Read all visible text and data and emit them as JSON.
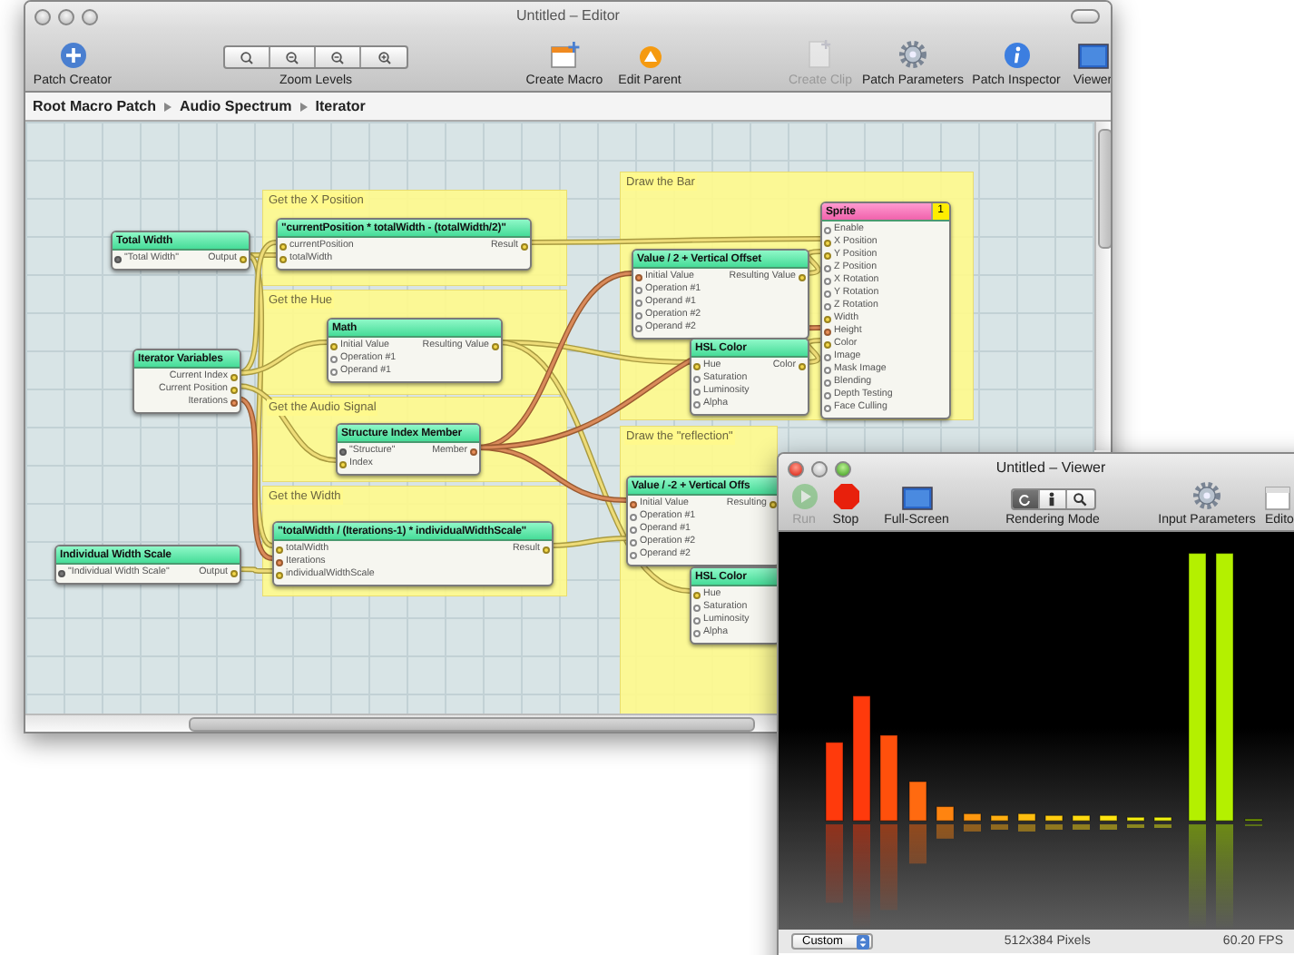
{
  "editor": {
    "title": "Untitled – Editor",
    "toolbar": [
      {
        "label": "Patch Creator",
        "kind": "patch-creator",
        "disabled": false
      },
      {
        "label": "Zoom Levels",
        "kind": "zoom",
        "disabled": false
      },
      {
        "label": "Create Macro",
        "kind": "macro",
        "disabled": false
      },
      {
        "label": "Edit Parent",
        "kind": "parent",
        "disabled": false
      },
      {
        "label": "Create Clip",
        "kind": "clip",
        "disabled": true
      },
      {
        "label": "Patch Parameters",
        "kind": "gear",
        "disabled": false
      },
      {
        "label": "Patch Inspector",
        "kind": "info",
        "disabled": false
      },
      {
        "label": "Viewer",
        "kind": "screen",
        "disabled": false
      }
    ],
    "breadcrumb": [
      "Root Macro Patch",
      "Audio Spectrum",
      "Iterator"
    ],
    "groups": [
      {
        "title": "Get the X Position"
      },
      {
        "title": "Get the Hue"
      },
      {
        "title": "Get the Audio Signal"
      },
      {
        "title": "Get the Width"
      },
      {
        "title": "Draw the Bar"
      },
      {
        "title": "Draw the \"reflection\""
      }
    ],
    "patches": [
      {
        "title": "Total Width",
        "kind": "processor",
        "inputs": [
          {
            "label": "\"Total Width\"",
            "kind": "fixed"
          }
        ],
        "outputs": [
          {
            "label": "Output",
            "kind": "linked"
          }
        ]
      },
      {
        "title": "\"currentPosition * totalWidth - (totalWidth/2)\"",
        "kind": "processor",
        "inputs": [
          {
            "label": "currentPosition",
            "kind": "linked"
          },
          {
            "label": "totalWidth",
            "kind": "linked"
          }
        ],
        "outputs": [
          {
            "label": "Result",
            "kind": "linked"
          }
        ]
      },
      {
        "title": "Iterator Variables",
        "kind": "processor",
        "outputs": [
          {
            "label": "Current Index",
            "kind": "linked"
          },
          {
            "label": "Current Position",
            "kind": "linked"
          },
          {
            "label": "Iterations",
            "kind": "index"
          }
        ]
      },
      {
        "title": "Math",
        "kind": "processor",
        "inputs": [
          {
            "label": "Initial Value",
            "kind": "linked"
          },
          {
            "label": "Operation #1",
            "kind": "open"
          },
          {
            "label": "Operand #1",
            "kind": "open"
          }
        ],
        "outputs": [
          {
            "label": "Resulting Value",
            "kind": "linked"
          }
        ]
      },
      {
        "title": "Structure Index Member",
        "kind": "processor",
        "inputs": [
          {
            "label": "\"Structure\"",
            "kind": "fixed"
          },
          {
            "label": "Index",
            "kind": "linked"
          }
        ],
        "outputs": [
          {
            "label": "Member",
            "kind": "index"
          }
        ]
      },
      {
        "title": "Individual Width Scale",
        "kind": "processor",
        "inputs": [
          {
            "label": "\"Individual Width Scale\"",
            "kind": "fixed"
          }
        ],
        "outputs": [
          {
            "label": "Output",
            "kind": "linked"
          }
        ]
      },
      {
        "title": "\"totalWidth / (Iterations-1) * individualWidthScale\"",
        "kind": "processor",
        "inputs": [
          {
            "label": "totalWidth",
            "kind": "linked"
          },
          {
            "label": "Iterations",
            "kind": "index"
          },
          {
            "label": "individualWidthScale",
            "kind": "linked"
          }
        ],
        "outputs": [
          {
            "label": "Result",
            "kind": "linked"
          }
        ]
      },
      {
        "title": "Value / 2 + Vertical Offset",
        "kind": "processor",
        "inputs": [
          {
            "label": "Initial Value",
            "kind": "index"
          },
          {
            "label": "Operation #1",
            "kind": "open"
          },
          {
            "label": "Operand #1",
            "kind": "open"
          },
          {
            "label": "Operation #2",
            "kind": "open"
          },
          {
            "label": "Operand #2",
            "kind": "open"
          }
        ],
        "outputs": [
          {
            "label": "Resulting Value",
            "kind": "linked"
          }
        ]
      },
      {
        "title": "HSL Color",
        "kind": "processor",
        "inputs": [
          {
            "label": "Hue",
            "kind": "linked"
          },
          {
            "label": "Saturation",
            "kind": "open"
          },
          {
            "label": "Luminosity",
            "kind": "open"
          },
          {
            "label": "Alpha",
            "kind": "open"
          }
        ],
        "outputs": [
          {
            "label": "Color",
            "kind": "linked"
          }
        ]
      },
      {
        "title": "Sprite",
        "kind": "consumer",
        "badge": "1",
        "inputs": [
          {
            "label": "Enable",
            "kind": "open"
          },
          {
            "label": "X Position",
            "kind": "linked"
          },
          {
            "label": "Y Position",
            "kind": "linked"
          },
          {
            "label": "Z Position",
            "kind": "open"
          },
          {
            "label": "X Rotation",
            "kind": "open"
          },
          {
            "label": "Y Rotation",
            "kind": "open"
          },
          {
            "label": "Z Rotation",
            "kind": "open"
          },
          {
            "label": "Width",
            "kind": "linked"
          },
          {
            "label": "Height",
            "kind": "index"
          },
          {
            "label": "Color",
            "kind": "linked"
          },
          {
            "label": "Image",
            "kind": "open"
          },
          {
            "label": "Mask Image",
            "kind": "open"
          },
          {
            "label": "Blending",
            "kind": "open"
          },
          {
            "label": "Depth Testing",
            "kind": "open"
          },
          {
            "label": "Face Culling",
            "kind": "open"
          }
        ]
      },
      {
        "title": "Value / -2 + Vertical Offs",
        "kind": "processor",
        "inputs": [
          {
            "label": "Initial Value",
            "kind": "index"
          },
          {
            "label": "Operation #1",
            "kind": "open"
          },
          {
            "label": "Operand #1",
            "kind": "open"
          },
          {
            "label": "Operation #2",
            "kind": "open"
          },
          {
            "label": "Operand #2",
            "kind": "open"
          }
        ],
        "outputs": [
          {
            "label": "Resulting",
            "kind": "linked"
          }
        ]
      },
      {
        "title": "HSL Color",
        "kind": "processor",
        "inputs": [
          {
            "label": "Hue",
            "kind": "linked"
          },
          {
            "label": "Saturation",
            "kind": "open"
          },
          {
            "label": "Luminosity",
            "kind": "open"
          },
          {
            "label": "Alpha",
            "kind": "open"
          }
        ]
      }
    ]
  },
  "viewer": {
    "title": "Untitled – Viewer",
    "toolbar": [
      {
        "label": "Run",
        "kind": "run",
        "disabled": true
      },
      {
        "label": "Stop",
        "kind": "stop",
        "disabled": false
      },
      {
        "label": "Full-Screen",
        "kind": "screen",
        "disabled": false
      },
      {
        "label": "Rendering Mode",
        "kind": "modes",
        "disabled": false,
        "modes": [
          {
            "selected": true
          },
          {
            "selected": false
          },
          {
            "selected": false
          }
        ]
      },
      {
        "label": "Input Parameters",
        "kind": "gear",
        "disabled": false
      },
      {
        "label": "Edito",
        "kind": "editor",
        "disabled": false
      }
    ],
    "size_menu": "Custom",
    "resolution": "512x384 Pixels",
    "fps": "60.20 FPS"
  }
}
